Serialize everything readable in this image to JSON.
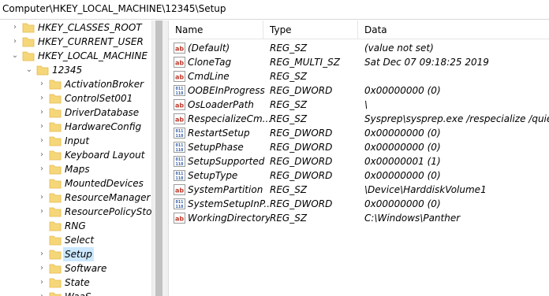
{
  "address": "Computer\\HKEY_LOCAL_MACHINE\\12345\\Setup",
  "tree": [
    {
      "label": "HKEY_CLASSES_ROOT",
      "chevron": "›"
    },
    {
      "label": "HKEY_CURRENT_USER",
      "chevron": "›"
    },
    {
      "label": "HKEY_LOCAL_MACHINE",
      "chevron": "⌄"
    },
    {
      "label": "12345",
      "chevron": "⌄"
    },
    {
      "label": "ActivationBroker",
      "chevron": "›"
    },
    {
      "label": "ControlSet001",
      "chevron": "›"
    },
    {
      "label": "DriverDatabase",
      "chevron": "›"
    },
    {
      "label": "HardwareConfig",
      "chevron": "›"
    },
    {
      "label": "Input",
      "chevron": "›"
    },
    {
      "label": "Keyboard Layout",
      "chevron": "›"
    },
    {
      "label": "Maps",
      "chevron": "›"
    },
    {
      "label": "MountedDevices",
      "chevron": ""
    },
    {
      "label": "ResourceManager",
      "chevron": "›"
    },
    {
      "label": "ResourcePolicyStore",
      "chevron": "›"
    },
    {
      "label": "RNG",
      "chevron": ""
    },
    {
      "label": "Select",
      "chevron": ""
    },
    {
      "label": "Setup",
      "chevron": "›",
      "selected": true
    },
    {
      "label": "Software",
      "chevron": "›"
    },
    {
      "label": "State",
      "chevron": "›"
    },
    {
      "label": "WaaS",
      "chevron": "›"
    }
  ],
  "columns": {
    "name": "Name",
    "type": "Type",
    "data": "Data"
  },
  "values": [
    {
      "icon": "string-value-icon",
      "name": "(Default)",
      "type": "REG_SZ",
      "data": "(value not set)"
    },
    {
      "icon": "string-value-icon",
      "name": "CloneTag",
      "type": "REG_MULTI_SZ",
      "data": "Sat Dec 07 09:18:25 2019"
    },
    {
      "icon": "string-value-icon",
      "name": "CmdLine",
      "type": "REG_SZ",
      "data": ""
    },
    {
      "icon": "binary-value-icon",
      "name": "OOBEInProgress",
      "type": "REG_DWORD",
      "data": "0x00000000 (0)"
    },
    {
      "icon": "string-value-icon",
      "name": "OsLoaderPath",
      "type": "REG_SZ",
      "data": "\\"
    },
    {
      "icon": "string-value-icon",
      "name": "RespecializeCm...",
      "type": "REG_SZ",
      "data": "Sysprep\\sysprep.exe /respecialize /quiet"
    },
    {
      "icon": "binary-value-icon",
      "name": "RestartSetup",
      "type": "REG_DWORD",
      "data": "0x00000000 (0)"
    },
    {
      "icon": "binary-value-icon",
      "name": "SetupPhase",
      "type": "REG_DWORD",
      "data": "0x00000000 (0)"
    },
    {
      "icon": "binary-value-icon",
      "name": "SetupSupported",
      "type": "REG_DWORD",
      "data": "0x00000001 (1)"
    },
    {
      "icon": "binary-value-icon",
      "name": "SetupType",
      "type": "REG_DWORD",
      "data": "0x00000000 (0)"
    },
    {
      "icon": "string-value-icon",
      "name": "SystemPartition",
      "type": "REG_SZ",
      "data": "\\Device\\HarddiskVolume1"
    },
    {
      "icon": "binary-value-icon",
      "name": "SystemSetupInP...",
      "type": "REG_DWORD",
      "data": "0x00000000 (0)"
    },
    {
      "icon": "string-value-icon",
      "name": "WorkingDirectory",
      "type": "REG_SZ",
      "data": "C:\\Windows\\Panther"
    }
  ],
  "colors": {
    "folder": "#f5d77a",
    "folder_dark": "#e6b94a",
    "selection": "#cce8ff",
    "string_icon": "#c0392b",
    "binary_icon": "#2f5da8"
  }
}
